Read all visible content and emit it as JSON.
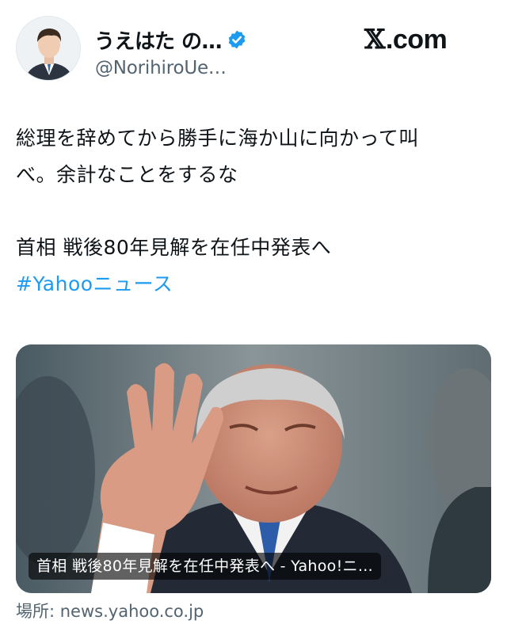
{
  "header": {
    "display_name": "うえはた の…",
    "handle": "@NorihiroUe…",
    "site_label": "X.com",
    "site_x_glyph": "𝕏",
    "site_suffix": ".com",
    "avatar_icon": "user-avatar",
    "verified_icon": "verified-badge-icon"
  },
  "tweet": {
    "line1": "総理を辞めてから勝手に海か山に向かって叫",
    "line2": "べ。余計なことをするな",
    "line3": "首相 戦後80年見解を在任中発表へ",
    "hashtag": "#Yahooニュース"
  },
  "card": {
    "title": "首相 戦後80年見解を在任中発表へ - Yahoo!ニ…",
    "image": "photo-of-man-waving"
  },
  "source": {
    "label": "場所: news.yahoo.co.jp"
  },
  "colors": {
    "text": "#0f1419",
    "secondary": "#536471",
    "link": "#1d9bf0",
    "verified": "#1d9bf0"
  }
}
